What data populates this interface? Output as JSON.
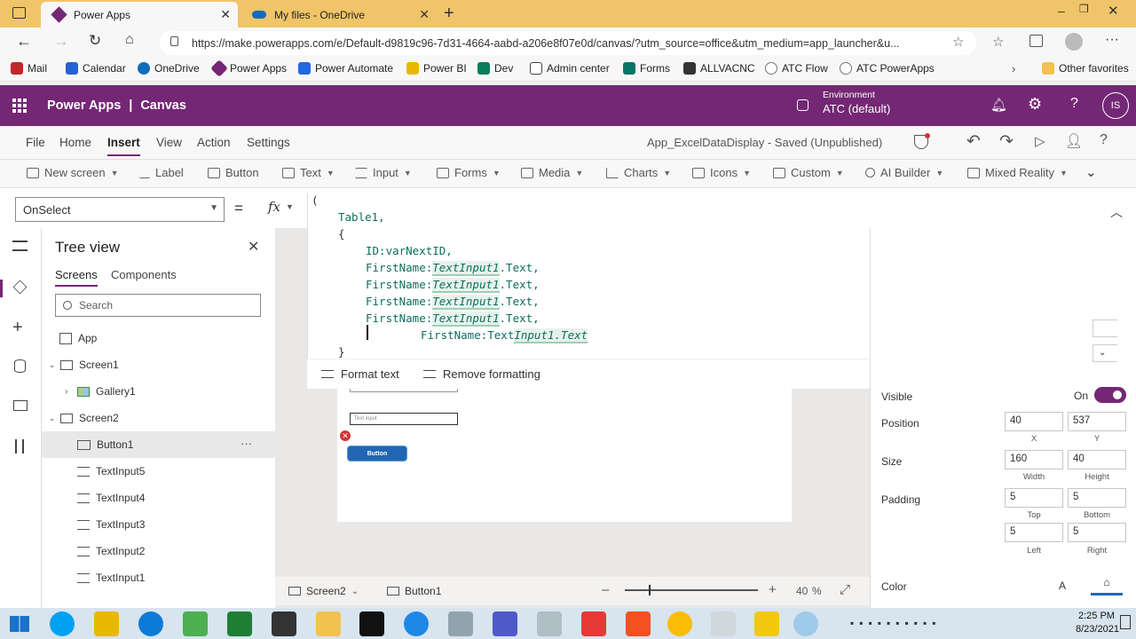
{
  "browser": {
    "tabs": [
      {
        "title": "Power Apps",
        "active": true
      },
      {
        "title": "My files - OneDrive",
        "active": false
      }
    ],
    "url": "https://make.powerapps.com/e/Default-d9819c96-7d31-4664-aabd-a206e8f07e0d/canvas/?utm_source=office&utm_medium=app_launcher&u...",
    "favorites": [
      "Mail",
      "Calendar",
      "OneDrive",
      "Power Apps",
      "Power Automate",
      "Power BI",
      "Dev",
      "Admin center",
      "Forms",
      "ALLVACNC",
      "ATC Flow",
      "ATC PowerApps"
    ],
    "other_favorites": "Other favorites"
  },
  "header": {
    "app_name": "Power Apps",
    "separator": "|",
    "mode": "Canvas",
    "env_label": "Environment",
    "env_name": "ATC (default)",
    "avatar": "IS"
  },
  "menubar": {
    "items": [
      "File",
      "Home",
      "Insert",
      "View",
      "Action",
      "Settings"
    ],
    "active": "Insert",
    "status": "App_ExcelDataDisplay - Saved (Unpublished)"
  },
  "toolbar": {
    "items": [
      "New screen",
      "Label",
      "Button",
      "Text",
      "Input",
      "Forms",
      "Media",
      "Charts",
      "Icons",
      "Custom",
      "AI Builder",
      "Mixed Reality"
    ]
  },
  "formula": {
    "property": "OnSelect",
    "equals": "=",
    "fx": "fx",
    "code": [
      "(",
      "Table1,",
      "{",
      "ID:varNextID,",
      "FirstName:",
      "TextInput1",
      ".Text,",
      "FirstName:Text",
      "Input1.Text",
      "}"
    ],
    "format_text": "Format text",
    "remove_formatting": "Remove formatting"
  },
  "tree": {
    "title": "Tree view",
    "tabs": [
      "Screens",
      "Components"
    ],
    "search_placeholder": "Search",
    "items": [
      {
        "label": "App",
        "level": 0
      },
      {
        "label": "Screen1",
        "level": 0
      },
      {
        "label": "Gallery1",
        "level": 1
      },
      {
        "label": "Screen2",
        "level": 0
      },
      {
        "label": "Button1",
        "level": 1
      },
      {
        "label": "TextInput5",
        "level": 1
      },
      {
        "label": "TextInput4",
        "level": 1
      },
      {
        "label": "TextInput3",
        "level": 1
      },
      {
        "label": "TextInput2",
        "level": 1
      },
      {
        "label": "TextInput1",
        "level": 1
      }
    ],
    "more": "···"
  },
  "canvas": {
    "text_input_placeholder": "Text input",
    "button_label": "Button"
  },
  "properties": {
    "visible_label": "Visible",
    "visible_value": "On",
    "position_label": "Position",
    "x": "40",
    "y": "537",
    "x_label": "X",
    "y_label": "Y",
    "size_label": "Size",
    "width": "160",
    "height": "40",
    "width_label": "Width",
    "height_label": "Height",
    "padding_label": "Padding",
    "pad_top": "5",
    "pad_bottom": "5",
    "pad_left": "5",
    "pad_right": "5",
    "top_label": "Top",
    "bottom_label": "Bottom",
    "left_label": "Left",
    "right_label": "Right",
    "color_label": "Color",
    "color_letter": "A"
  },
  "statusbar": {
    "screen": "Screen2",
    "control": "Button1",
    "zoom": "40",
    "zoom_unit": "%"
  },
  "taskbar": {
    "time": "2:25 PM",
    "date": "8/23/2021"
  }
}
